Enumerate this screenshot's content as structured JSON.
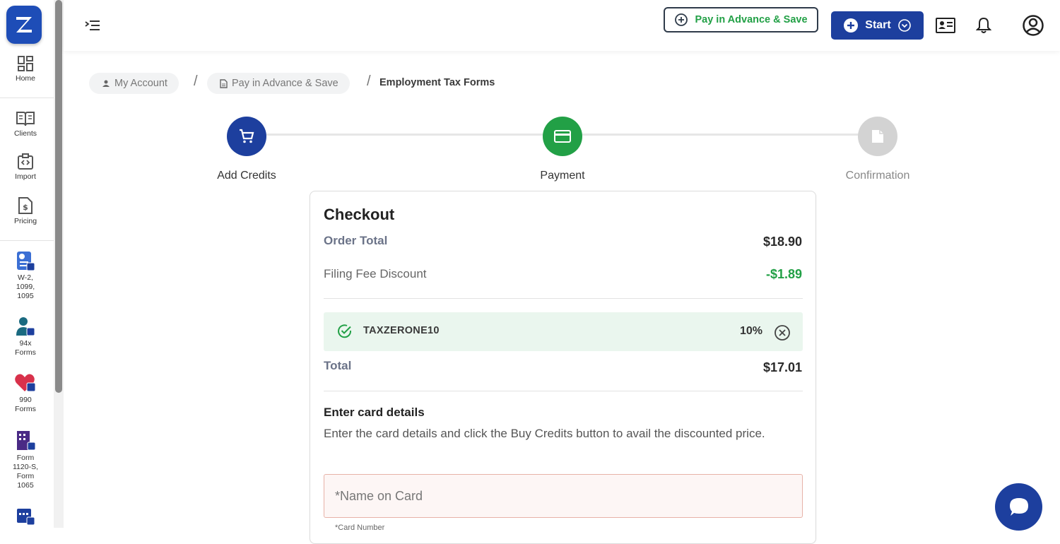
{
  "sidebar": {
    "items": [
      {
        "label": "Home",
        "icon": "dashboard-grid-icon"
      },
      {
        "label": "Clients",
        "icon": "open-book-icon"
      },
      {
        "label": "Import",
        "icon": "import-code-icon"
      },
      {
        "label": "Pricing",
        "icon": "dollar-document-icon"
      },
      {
        "label": "W-2,\n1099,\n1095",
        "icon": "w2-form-icon"
      },
      {
        "label": "94x\nForms",
        "icon": "business-person-icon"
      },
      {
        "label": "990\nForms",
        "icon": "heart-icon"
      },
      {
        "label": "Form\n1120-S,\nForm\n1065",
        "icon": "building-icon"
      },
      {
        "label": "",
        "icon": "calendar-icon"
      }
    ]
  },
  "header": {
    "pay_advance_label": "Pay in Advance & Save",
    "start_label": "Start"
  },
  "breadcrumb": {
    "items": [
      "My Account",
      "Pay in Advance & Save"
    ],
    "current": "Employment Tax Forms",
    "separator": "/"
  },
  "stepper": {
    "steps": [
      {
        "label": "Add Credits",
        "state": "done"
      },
      {
        "label": "Payment",
        "state": "active"
      },
      {
        "label": "Confirmation",
        "state": "pending"
      }
    ]
  },
  "checkout": {
    "title": "Checkout",
    "order_total_label": "Order Total",
    "order_total_value": "$18.90",
    "discount_label": "Filing Fee Discount",
    "discount_value": "-$1.89",
    "coupon_code": "TAXZERONE10",
    "coupon_percent": "10%",
    "total_label": "Total",
    "total_value": "$17.01",
    "card_title": "Enter card details",
    "card_desc": "Enter the card details and click the Buy Credits button to avail the discounted price.",
    "name_placeholder": "*Name on Card",
    "card_number_label": "*Card Number"
  },
  "colors": {
    "brand_blue": "#1d3f9e",
    "success_green": "#22a046",
    "coupon_bg": "#eaf6ee",
    "pending_gray": "#d3d3d3"
  }
}
